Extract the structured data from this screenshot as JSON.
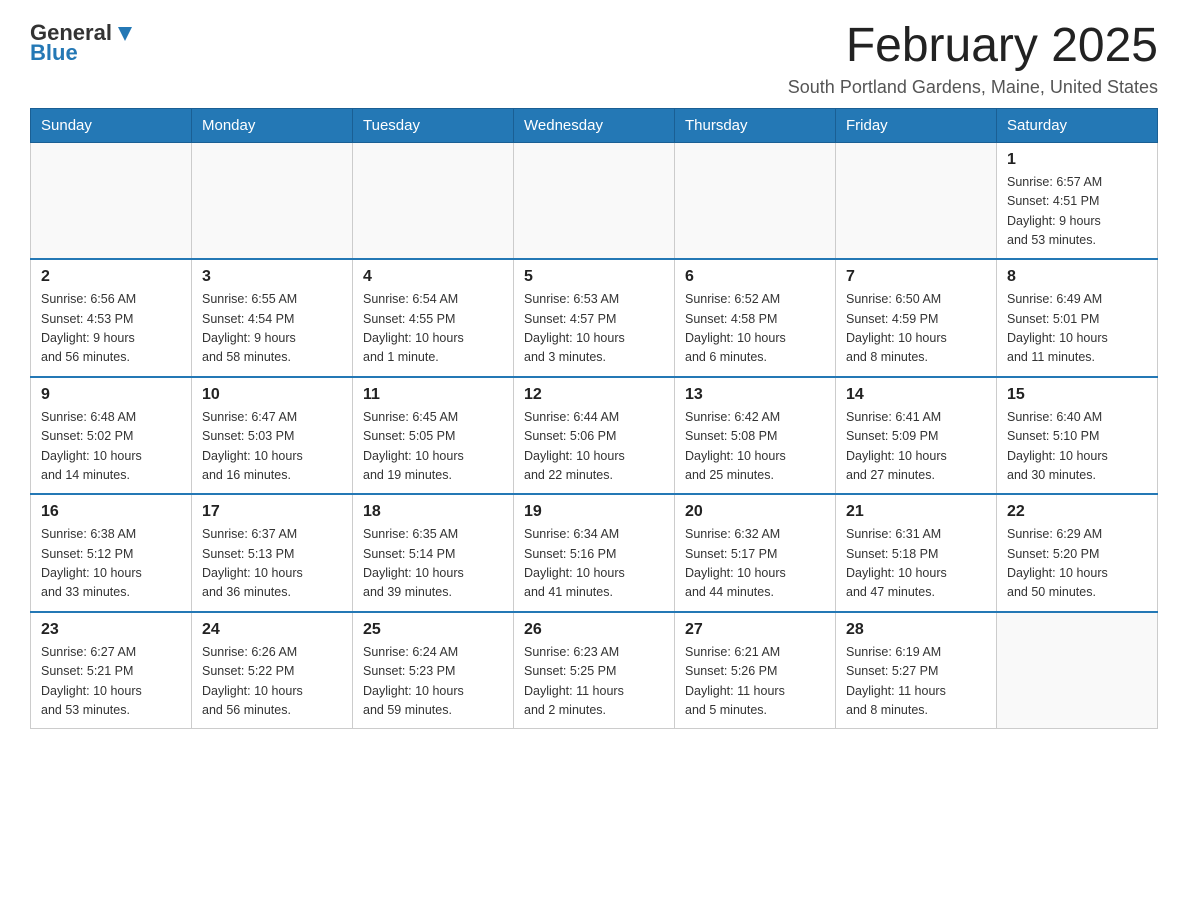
{
  "logo": {
    "text_general": "General",
    "text_blue": "Blue"
  },
  "title": "February 2025",
  "location": "South Portland Gardens, Maine, United States",
  "days_of_week": [
    "Sunday",
    "Monday",
    "Tuesday",
    "Wednesday",
    "Thursday",
    "Friday",
    "Saturday"
  ],
  "weeks": [
    [
      {
        "day": "",
        "info": ""
      },
      {
        "day": "",
        "info": ""
      },
      {
        "day": "",
        "info": ""
      },
      {
        "day": "",
        "info": ""
      },
      {
        "day": "",
        "info": ""
      },
      {
        "day": "",
        "info": ""
      },
      {
        "day": "1",
        "info": "Sunrise: 6:57 AM\nSunset: 4:51 PM\nDaylight: 9 hours\nand 53 minutes."
      }
    ],
    [
      {
        "day": "2",
        "info": "Sunrise: 6:56 AM\nSunset: 4:53 PM\nDaylight: 9 hours\nand 56 minutes."
      },
      {
        "day": "3",
        "info": "Sunrise: 6:55 AM\nSunset: 4:54 PM\nDaylight: 9 hours\nand 58 minutes."
      },
      {
        "day": "4",
        "info": "Sunrise: 6:54 AM\nSunset: 4:55 PM\nDaylight: 10 hours\nand 1 minute."
      },
      {
        "day": "5",
        "info": "Sunrise: 6:53 AM\nSunset: 4:57 PM\nDaylight: 10 hours\nand 3 minutes."
      },
      {
        "day": "6",
        "info": "Sunrise: 6:52 AM\nSunset: 4:58 PM\nDaylight: 10 hours\nand 6 minutes."
      },
      {
        "day": "7",
        "info": "Sunrise: 6:50 AM\nSunset: 4:59 PM\nDaylight: 10 hours\nand 8 minutes."
      },
      {
        "day": "8",
        "info": "Sunrise: 6:49 AM\nSunset: 5:01 PM\nDaylight: 10 hours\nand 11 minutes."
      }
    ],
    [
      {
        "day": "9",
        "info": "Sunrise: 6:48 AM\nSunset: 5:02 PM\nDaylight: 10 hours\nand 14 minutes."
      },
      {
        "day": "10",
        "info": "Sunrise: 6:47 AM\nSunset: 5:03 PM\nDaylight: 10 hours\nand 16 minutes."
      },
      {
        "day": "11",
        "info": "Sunrise: 6:45 AM\nSunset: 5:05 PM\nDaylight: 10 hours\nand 19 minutes."
      },
      {
        "day": "12",
        "info": "Sunrise: 6:44 AM\nSunset: 5:06 PM\nDaylight: 10 hours\nand 22 minutes."
      },
      {
        "day": "13",
        "info": "Sunrise: 6:42 AM\nSunset: 5:08 PM\nDaylight: 10 hours\nand 25 minutes."
      },
      {
        "day": "14",
        "info": "Sunrise: 6:41 AM\nSunset: 5:09 PM\nDaylight: 10 hours\nand 27 minutes."
      },
      {
        "day": "15",
        "info": "Sunrise: 6:40 AM\nSunset: 5:10 PM\nDaylight: 10 hours\nand 30 minutes."
      }
    ],
    [
      {
        "day": "16",
        "info": "Sunrise: 6:38 AM\nSunset: 5:12 PM\nDaylight: 10 hours\nand 33 minutes."
      },
      {
        "day": "17",
        "info": "Sunrise: 6:37 AM\nSunset: 5:13 PM\nDaylight: 10 hours\nand 36 minutes."
      },
      {
        "day": "18",
        "info": "Sunrise: 6:35 AM\nSunset: 5:14 PM\nDaylight: 10 hours\nand 39 minutes."
      },
      {
        "day": "19",
        "info": "Sunrise: 6:34 AM\nSunset: 5:16 PM\nDaylight: 10 hours\nand 41 minutes."
      },
      {
        "day": "20",
        "info": "Sunrise: 6:32 AM\nSunset: 5:17 PM\nDaylight: 10 hours\nand 44 minutes."
      },
      {
        "day": "21",
        "info": "Sunrise: 6:31 AM\nSunset: 5:18 PM\nDaylight: 10 hours\nand 47 minutes."
      },
      {
        "day": "22",
        "info": "Sunrise: 6:29 AM\nSunset: 5:20 PM\nDaylight: 10 hours\nand 50 minutes."
      }
    ],
    [
      {
        "day": "23",
        "info": "Sunrise: 6:27 AM\nSunset: 5:21 PM\nDaylight: 10 hours\nand 53 minutes."
      },
      {
        "day": "24",
        "info": "Sunrise: 6:26 AM\nSunset: 5:22 PM\nDaylight: 10 hours\nand 56 minutes."
      },
      {
        "day": "25",
        "info": "Sunrise: 6:24 AM\nSunset: 5:23 PM\nDaylight: 10 hours\nand 59 minutes."
      },
      {
        "day": "26",
        "info": "Sunrise: 6:23 AM\nSunset: 5:25 PM\nDaylight: 11 hours\nand 2 minutes."
      },
      {
        "day": "27",
        "info": "Sunrise: 6:21 AM\nSunset: 5:26 PM\nDaylight: 11 hours\nand 5 minutes."
      },
      {
        "day": "28",
        "info": "Sunrise: 6:19 AM\nSunset: 5:27 PM\nDaylight: 11 hours\nand 8 minutes."
      },
      {
        "day": "",
        "info": ""
      }
    ]
  ]
}
